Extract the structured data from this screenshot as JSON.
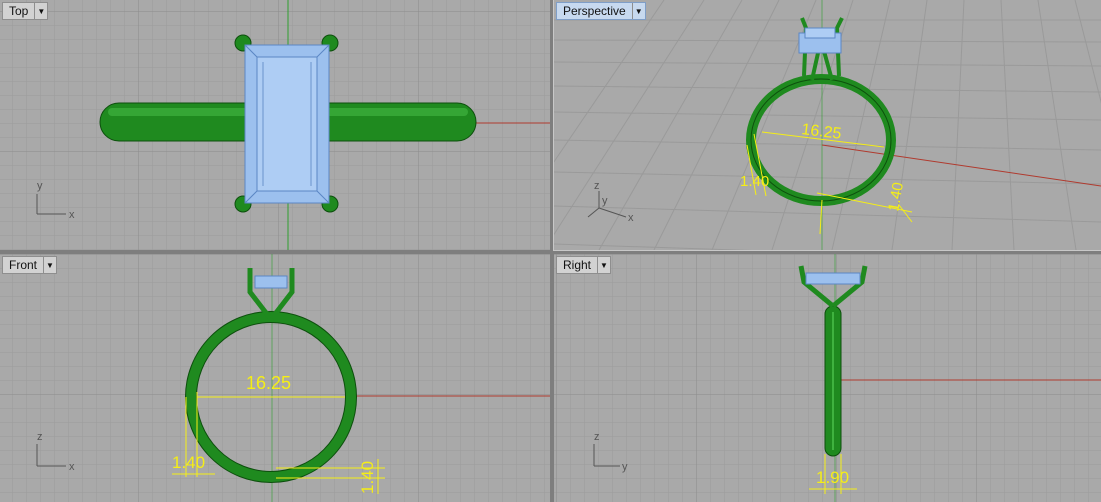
{
  "viewports": [
    {
      "name": "Top",
      "axis_x": "x",
      "axis_y": "y"
    },
    {
      "name": "Perspective",
      "axis_x": "x",
      "axis_y": "y",
      "axis_z": "z",
      "dims": {
        "diameter": "16.25",
        "band_width": "1.40",
        "band_height": "1.40"
      }
    },
    {
      "name": "Front",
      "axis_x": "x",
      "axis_y": "z",
      "dims": {
        "diameter": "16.25",
        "band_width": "1.40",
        "band_height": "1.40"
      }
    },
    {
      "name": "Right",
      "axis_x": "y",
      "axis_y": "z",
      "dims": {
        "band_width": "1.90"
      }
    }
  ],
  "colors": {
    "background": "#a9a9a9",
    "gridline": "#9b9b9b",
    "major_gridline": "#8e8e8e",
    "ring": "#1f8a1f",
    "gem": "#9cc0ee",
    "dimension": "#f5ee16",
    "axis_x": "#b03a2e",
    "axis_y": "#2f9e2f"
  },
  "icons": {
    "dropdown": "triangle-down"
  }
}
